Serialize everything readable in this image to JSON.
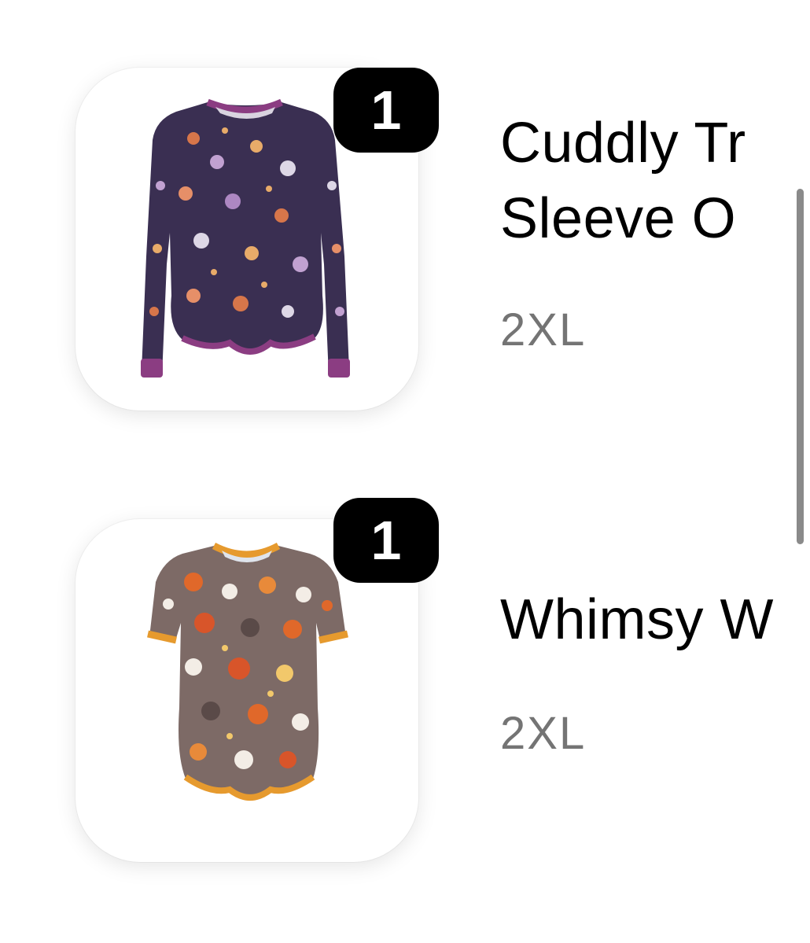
{
  "cart_items": [
    {
      "title_line1": "Cuddly Tr",
      "title_line2": "Sleeve O",
      "variant": "2XL",
      "quantity": "1",
      "image_icon": "long-sleeve-onesie-purple-print",
      "colors": {
        "body": "#3a2f52",
        "trim": "#8b3d82"
      }
    },
    {
      "title_line1": "Whimsy W",
      "variant": "2XL",
      "quantity": "1",
      "image_icon": "short-sleeve-onesie-orange-print",
      "colors": {
        "body": "#7d6a66",
        "trim": "#e69a2e"
      }
    }
  ],
  "colors": {
    "badge_bg": "#000000",
    "badge_text": "#ffffff",
    "title": "#000000",
    "variant": "#747474"
  }
}
